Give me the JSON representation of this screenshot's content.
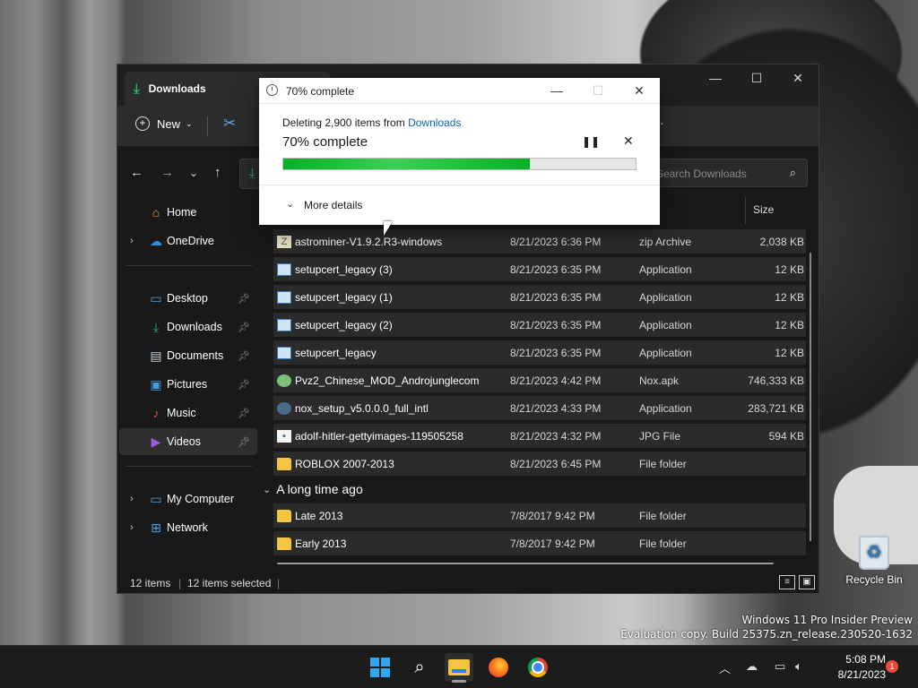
{
  "explorer": {
    "title": "Downloads",
    "toolbar": {
      "new_label": "New"
    },
    "search_placeholder": "Search Downloads",
    "sidebar": [
      {
        "label": "Home",
        "icon": "home-icon"
      },
      {
        "label": "OneDrive",
        "icon": "cloud-icon"
      },
      {
        "label": "Desktop",
        "icon": "desktop-icon"
      },
      {
        "label": "Downloads",
        "icon": "download-icon"
      },
      {
        "label": "Documents",
        "icon": "document-icon"
      },
      {
        "label": "Pictures",
        "icon": "pictures-icon"
      },
      {
        "label": "Music",
        "icon": "music-icon"
      },
      {
        "label": "Videos",
        "icon": "videos-icon"
      },
      {
        "label": "My Computer",
        "icon": "computer-icon"
      },
      {
        "label": "Network",
        "icon": "network-icon"
      }
    ],
    "columns": {
      "size": "Size"
    },
    "files": [
      {
        "name": "astrominer-V1.9.2.R3-windows",
        "date": "8/21/2023 6:36 PM",
        "type": "zip Archive",
        "size": "2,038 KB",
        "icon": "zip-icon"
      },
      {
        "name": "setupcert_legacy (3)",
        "date": "8/21/2023 6:35 PM",
        "type": "Application",
        "size": "12 KB",
        "icon": "app-icon"
      },
      {
        "name": "setupcert_legacy (1)",
        "date": "8/21/2023 6:35 PM",
        "type": "Application",
        "size": "12 KB",
        "icon": "app-icon"
      },
      {
        "name": "setupcert_legacy (2)",
        "date": "8/21/2023 6:35 PM",
        "type": "Application",
        "size": "12 KB",
        "icon": "app-icon"
      },
      {
        "name": "setupcert_legacy",
        "date": "8/21/2023 6:35 PM",
        "type": "Application",
        "size": "12 KB",
        "icon": "app-icon"
      },
      {
        "name": "Pvz2_Chinese_MOD_Androjunglecom",
        "date": "8/21/2023 4:42 PM",
        "type": "Nox.apk",
        "size": "746,333 KB",
        "icon": "apk-icon"
      },
      {
        "name": "nox_setup_v5.0.0.0_full_intl",
        "date": "8/21/2023 4:33 PM",
        "type": "Application",
        "size": "283,721 KB",
        "icon": "installer-icon"
      },
      {
        "name": "adolf-hitler-gettyimages-119505258",
        "date": "8/21/2023 4:32 PM",
        "type": "JPG File",
        "size": "594 KB",
        "icon": "image-file-icon"
      },
      {
        "name": "ROBLOX 2007-2013",
        "date": "8/21/2023 6:45 PM",
        "type": "File folder",
        "size": "",
        "icon": "folder-icon"
      }
    ],
    "group_label": "A long time ago",
    "old_files": [
      {
        "name": "Late 2013",
        "date": "7/8/2017 9:42 PM",
        "type": "File folder",
        "size": "",
        "icon": "folder-icon"
      },
      {
        "name": "Early 2013",
        "date": "7/8/2017 9:42 PM",
        "type": "File folder",
        "size": "",
        "icon": "folder-icon"
      }
    ],
    "status": {
      "count": "12 items",
      "selected": "12 items selected"
    }
  },
  "dialog": {
    "title": "70% complete",
    "line_prefix": "Deleting 2,900 items from",
    "line_link": "Downloads",
    "percent_text": "70% complete",
    "progress": 0.7,
    "more_details": "More details"
  },
  "desktop": {
    "recycle_bin": "Recycle Bin",
    "watermark_1": "Windows 11 Pro Insider Preview",
    "watermark_2": "Evaluation copy. Build 25375.zn_release.230520-1632"
  },
  "taskbar": {
    "time": "5:08 PM",
    "date": "8/21/2023",
    "notifications": "1"
  },
  "colors": {
    "progress": "#06b025",
    "link": "#0b62c4",
    "accent_download": "#29b36a"
  }
}
